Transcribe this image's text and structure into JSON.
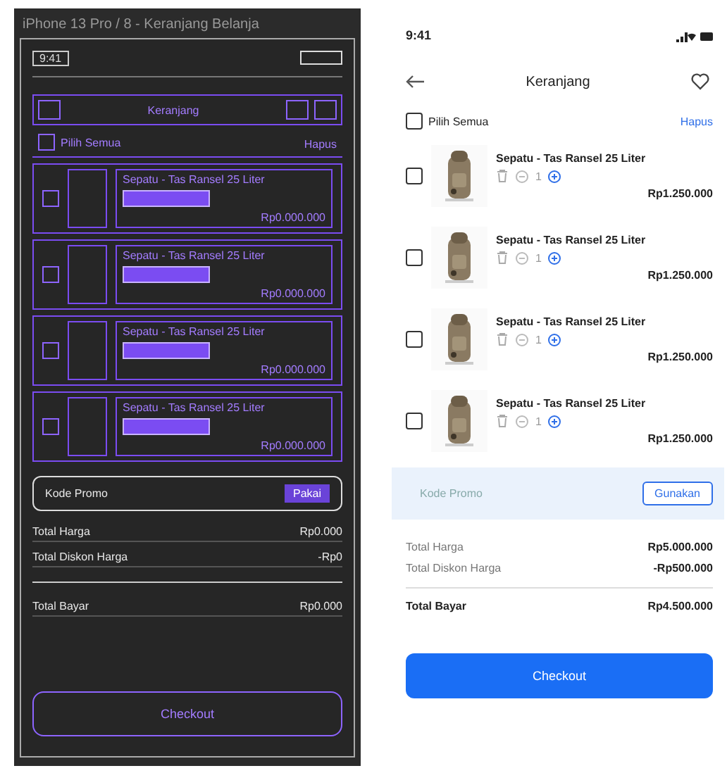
{
  "wireframe": {
    "title": "iPhone 13 Pro / 8 - Keranjang Belanja",
    "status_time": "9:41",
    "header_title": "Keranjang",
    "select_all": {
      "label": "Pilih Semua",
      "checked": false
    },
    "delete_label": "Hapus",
    "items": [
      {
        "name": "Sepatu - Tas Ransel 25 Liter",
        "price": "Rp0.000.000"
      },
      {
        "name": "Sepatu - Tas Ransel 25 Liter",
        "price": "Rp0.000.000"
      },
      {
        "name": "Sepatu - Tas Ransel 25 Liter",
        "price": "Rp0.000.000"
      },
      {
        "name": "Sepatu - Tas Ransel 25 Liter",
        "price": "Rp0.000.000"
      }
    ],
    "promo": {
      "placeholder": "Kode Promo",
      "button": "Pakai"
    },
    "summary": [
      {
        "label": "Total Harga",
        "value": "Rp0.000"
      },
      {
        "label": "Total Diskon Harga",
        "value": "-Rp0"
      }
    ],
    "total": {
      "label": "Total Bayar",
      "value": "Rp0.000"
    },
    "button": "Checkout"
  },
  "phone": {
    "status_time": "9:41",
    "header_title": "Keranjang",
    "select_all": {
      "label": "Pilih Semua",
      "checked": false
    },
    "delete_label": "Hapus",
    "items": [
      {
        "name": "Sepatu - Tas Ransel 25 Liter",
        "quantity": "1",
        "price": "Rp1.250.000",
        "checked": false
      },
      {
        "name": "Sepatu - Tas Ransel 25 Liter",
        "quantity": "1",
        "price": "Rp1.250.000",
        "checked": false
      },
      {
        "name": "Sepatu - Tas Ransel 25 Liter",
        "quantity": "1",
        "price": "Rp1.250.000",
        "checked": false
      },
      {
        "name": "Sepatu - Tas Ransel 25 Liter",
        "quantity": "1",
        "price": "Rp1.250.000",
        "checked": false
      }
    ],
    "promo": {
      "placeholder": "Kode Promo",
      "button": "Gunakan"
    },
    "summary": [
      {
        "label": "Total Harga",
        "value": "Rp5.000.000"
      },
      {
        "label": "Total Diskon Harga",
        "value": "-Rp500.000"
      }
    ],
    "total": {
      "label": "Total Bayar",
      "value": "Rp4.500.000"
    },
    "button": "Checkout"
  }
}
